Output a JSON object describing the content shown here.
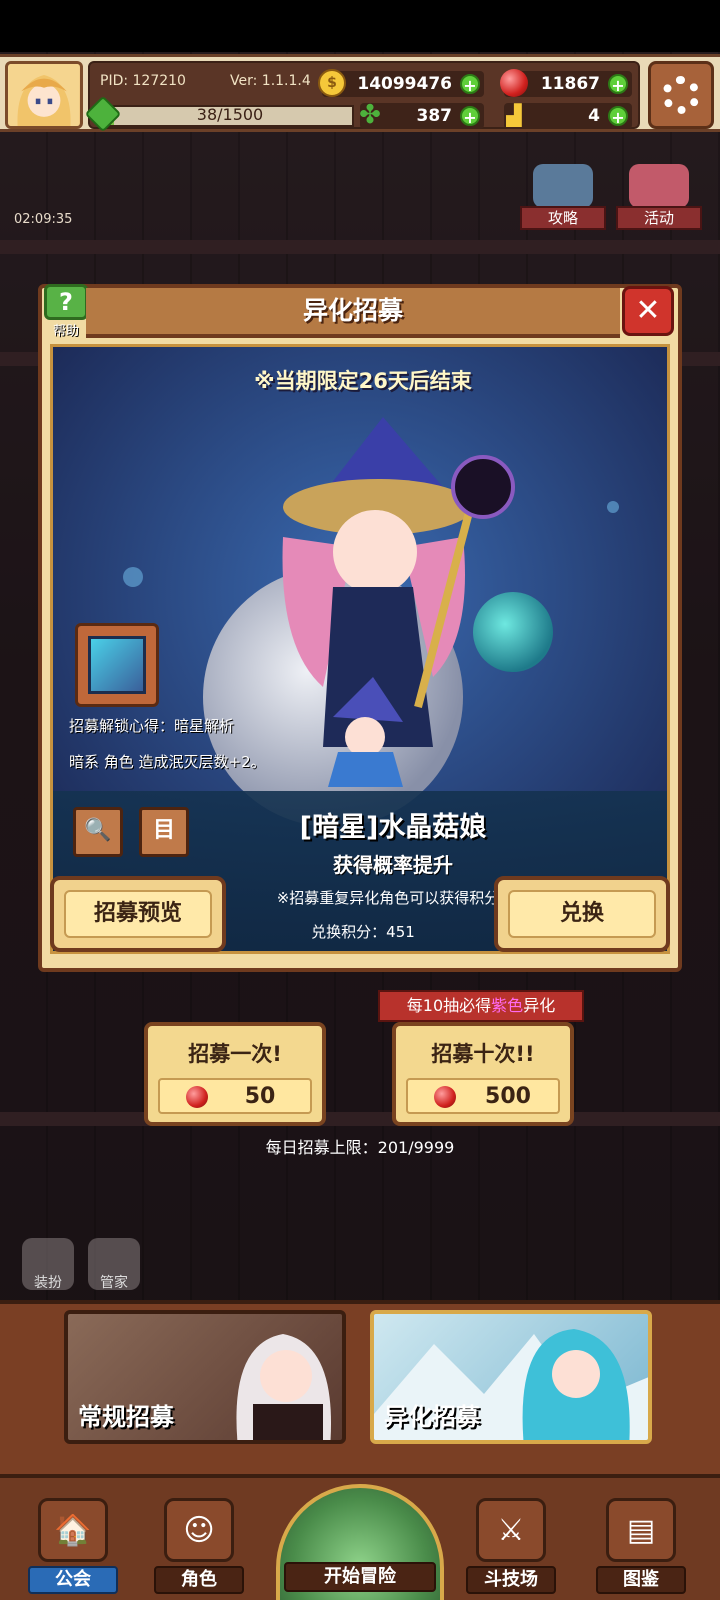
{
  "hud": {
    "pid": "PID: 127210",
    "version": "Ver: 1.1.1.4",
    "gold": "14099476",
    "ruby": "11867",
    "energy": "38/1500",
    "energy_fraction": 0.025,
    "clover": "387",
    "shoe": "4"
  },
  "scene": {
    "clock": "02:09:35",
    "strategy_label": "攻略",
    "activity_label": "活动",
    "dress_label": "装扮",
    "butler_label": "管家"
  },
  "modal": {
    "title": "异化招募",
    "help_label": "帮助",
    "close_glyph": "✕",
    "limit_text": "※当期限定26天后结束",
    "unlock_line1": "招募解锁心得：暗星解析",
    "unlock_line2": "暗系 角色 造成泯灭层数+2。",
    "hero_name": "[暗星]水晶菇娘",
    "rate_up": "获得概率提升",
    "note": "※招募重复异化角色可以获得积分",
    "points": "兑换积分：451",
    "preview_button": "招募预览",
    "exchange_button": "兑换",
    "search_glyph": "🔍",
    "list_glyph": "目"
  },
  "recruit": {
    "tag_prefix": "每10抽必得",
    "tag_highlight": "紫色",
    "tag_suffix": "异化",
    "single_title": "招募一次!",
    "single_cost": "50",
    "ten_title": "招募十次!!",
    "ten_cost": "500",
    "daily_limit": "每日招募上限：201/9999"
  },
  "gacha_tabs": {
    "normal": "常规招募",
    "alien": "异化招募"
  },
  "nav": {
    "guild": "公会",
    "character": "角色",
    "adventure": "开始冒险",
    "arena": "斗技场",
    "codex": "图鉴"
  },
  "colors": {
    "accent_gold": "#f1dba3",
    "close_red": "#d0342c",
    "help_green": "#58b246",
    "purple_highlight": "#ff6af0"
  }
}
